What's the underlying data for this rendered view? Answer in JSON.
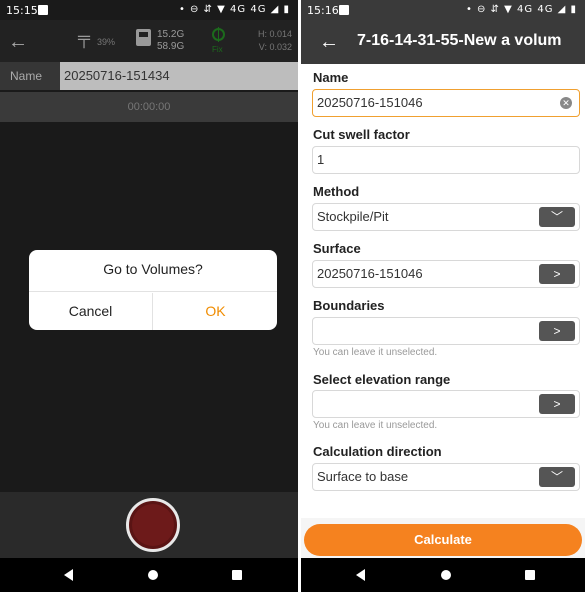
{
  "left_screen": {
    "status_bar": {
      "time": "15:15",
      "icons": "• ⊖ ⇵ ▼ 4G 4G ◢ ▮"
    },
    "toolbar": {
      "battery_percent": "39%",
      "memory_line1": "15.2G",
      "memory_line2": "58.9G",
      "fix_label": "Fix",
      "h_value": "H: 0.014",
      "v_value": "V: 0.032"
    },
    "name_label": "Name",
    "name_value": "20250716-151434",
    "timer": "00:00:00",
    "dialog": {
      "title": "Go to Volumes?",
      "cancel_label": "Cancel",
      "ok_label": "OK"
    }
  },
  "right_screen": {
    "status_bar": {
      "time": "15:16",
      "icons": "• ⊖ ⇵ ▼ 4G 4G ◢ ▮"
    },
    "title": "7-16-14-31-55-New a volum",
    "fields": {
      "name": {
        "label": "Name",
        "value": "20250716-151046"
      },
      "cut_swell": {
        "label": "Cut swell factor",
        "value": "1"
      },
      "method": {
        "label": "Method",
        "value": "Stockpile/Pit"
      },
      "surface": {
        "label": "Surface",
        "value": "20250716-151046"
      },
      "boundaries": {
        "label": "Boundaries",
        "value": "",
        "hint": "You can leave it unselected."
      },
      "elevation_range": {
        "label": "Select elevation range",
        "value": "",
        "hint": "You can leave it unselected."
      },
      "calc_direction": {
        "label": "Calculation direction",
        "value": "Surface to base"
      }
    },
    "calculate_label": "Calculate"
  },
  "icons": {
    "dropdown": "chevron-down-icon",
    "next": "chevron-right-icon",
    "clear": "clear-icon",
    "back": "arrow-back-icon"
  },
  "colors": {
    "accent": "#f5821f",
    "ok_text": "#f08c00",
    "fix_green": "#1c6b1c",
    "active_border": "#f0a030"
  }
}
